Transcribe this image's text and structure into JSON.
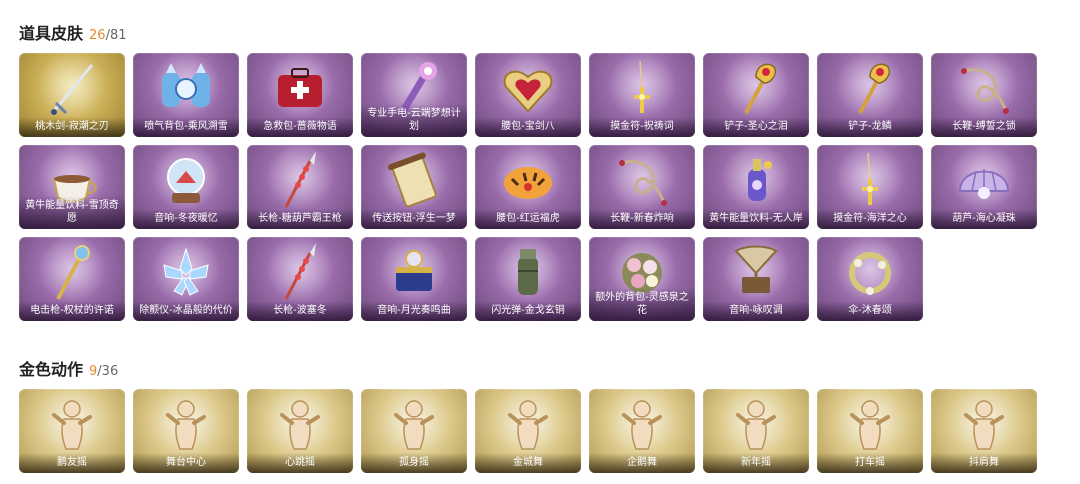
{
  "sections": [
    {
      "title": "道具皮肤",
      "count_current": "26",
      "count_total": "/81",
      "items": [
        {
          "name": "桃木剑-寂潮之刃",
          "icon": "sword-icon"
        },
        {
          "name": "喷气背包-乘风溯雪",
          "icon": "jetpack-icon"
        },
        {
          "name": "急救包-蔷薇物语",
          "icon": "medkit-icon"
        },
        {
          "name": "专业手电-云端梦想计划",
          "icon": "flashlight-icon"
        },
        {
          "name": "腰包-宝剑八",
          "icon": "heart-bag-icon"
        },
        {
          "name": "摸金符-祝祷词",
          "icon": "charm-icon"
        },
        {
          "name": "铲子-圣心之泪",
          "icon": "shovel-icon"
        },
        {
          "name": "铲子-龙鳞",
          "icon": "shovel-icon"
        },
        {
          "name": "长鞭-缚誓之锁",
          "icon": "whip-icon"
        },
        {
          "name": "黄牛能量饮料-雪顶奇愿",
          "icon": "teacup-icon"
        },
        {
          "name": "音响-冬夜暖忆",
          "icon": "snowglobe-icon"
        },
        {
          "name": "长枪-糖葫芦霸王枪",
          "icon": "spear-icon"
        },
        {
          "name": "传送按钮-浮生一梦",
          "icon": "scroll-icon"
        },
        {
          "name": "腰包-红运福虎",
          "icon": "tiger-bag-icon"
        },
        {
          "name": "长鞭-新春炸响",
          "icon": "whip-icon"
        },
        {
          "name": "黄牛能量饮料-无人岸",
          "icon": "bottle-icon"
        },
        {
          "name": "摸金符-海洋之心",
          "icon": "charm-icon"
        },
        {
          "name": "葫芦-海心凝珠",
          "icon": "shell-icon"
        },
        {
          "name": "电击枪-权杖的许诺",
          "icon": "scepter-icon"
        },
        {
          "name": "除颤仪-冰晶般的代价",
          "icon": "ice-flower-icon"
        },
        {
          "name": "长枪-波塞冬",
          "icon": "spear-icon"
        },
        {
          "name": "音响-月光奏鸣曲",
          "icon": "music-box-icon"
        },
        {
          "name": "闪光弹-金戈玄铜",
          "icon": "grenade-icon"
        },
        {
          "name": "额外的背包-灵感泉之花",
          "icon": "flower-icon"
        },
        {
          "name": "音响-咏叹调",
          "icon": "gramophone-icon"
        },
        {
          "name": "伞-沐春颂",
          "icon": "wreath-icon"
        }
      ]
    },
    {
      "title": "金色动作",
      "count_current": "9",
      "count_total": "/36",
      "items": [
        {
          "name": "鹏友摇",
          "icon": "pose-icon"
        },
        {
          "name": "舞台中心",
          "icon": "pose-icon"
        },
        {
          "name": "心跳摇",
          "icon": "pose-icon"
        },
        {
          "name": "孤身摇",
          "icon": "pose-icon"
        },
        {
          "name": "金城舞",
          "icon": "pose-icon"
        },
        {
          "name": "企鹅舞",
          "icon": "pose-icon"
        },
        {
          "name": "新年摇",
          "icon": "pose-icon"
        },
        {
          "name": "打车摇",
          "icon": "pose-icon"
        },
        {
          "name": "抖肩舞",
          "icon": "pose-icon"
        }
      ]
    }
  ]
}
